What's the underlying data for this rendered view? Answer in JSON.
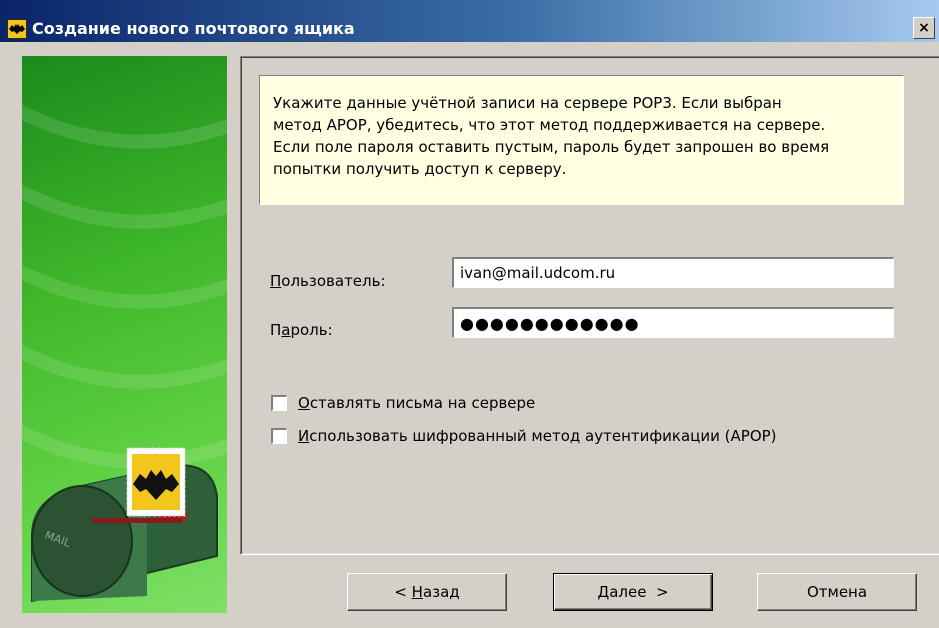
{
  "window": {
    "title": "Создание нового почтового ящика",
    "close_label": "×"
  },
  "info": {
    "line1": "Укажите данные учётной записи на сервере POP3. Если выбран",
    "line2": "метод APOP, убедитесь, что этот метод поддерживается на сервере.",
    "line3": "Если поле пароля оставить пустым, пароль будет запрошен во время",
    "line4": "попытки получить доступ к серверу."
  },
  "form": {
    "user_label_accel": "П",
    "user_label_rest": "ользователь:",
    "user_value": "ivan@mail.udcom.ru",
    "password_label_pre": "П",
    "password_label_accel": "а",
    "password_label_rest": "роль:",
    "password_value": "●●●●●●●●●●●●"
  },
  "options": {
    "leave_on_server_accel": "О",
    "leave_on_server_rest": "ставлять письма на сервере",
    "leave_on_server_checked": false,
    "apop_accel": "И",
    "apop_rest": "спользовать шифрованный метод аутентификации (APOP)",
    "apop_checked": false
  },
  "buttons": {
    "back_pre": "< ",
    "back_accel": "Н",
    "back_rest": "азад",
    "next_accel": "Д",
    "next_rest": "алее  >",
    "cancel": "Отмена"
  },
  "illustration": {
    "mailbox_text": "MAIL"
  },
  "colors": {
    "title_gradient_start": "#0a246a",
    "title_gradient_end": "#a6caf0",
    "info_background": "#ffffe1",
    "side_panel_green": "#3fb82a",
    "dialog_face": "#d4d0c8"
  }
}
